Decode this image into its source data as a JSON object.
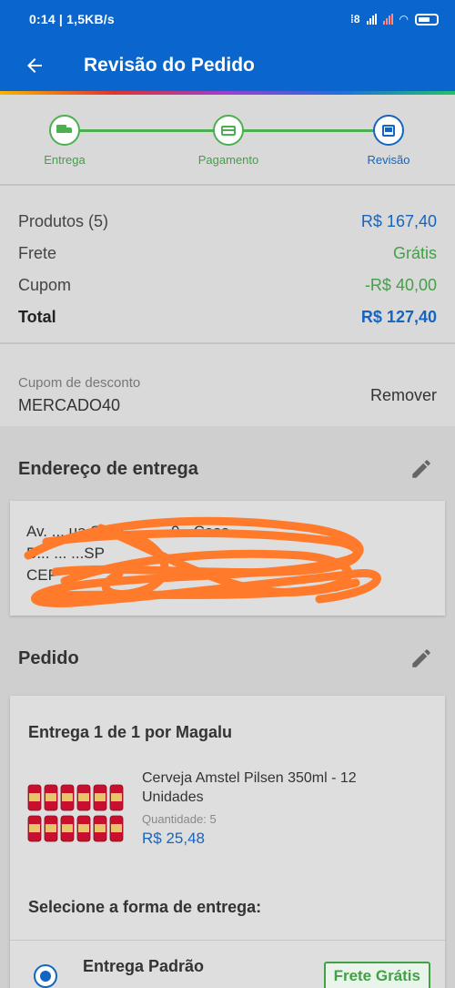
{
  "status_bar": {
    "time_info": "0:14 | 1,5KB/s",
    "alarm_icon": "alarm-icon"
  },
  "app_bar": {
    "title": "Revisão do Pedido"
  },
  "stepper": {
    "steps": [
      {
        "label": "Entrega",
        "state": "done",
        "icon": "truck-icon"
      },
      {
        "label": "Pagamento",
        "state": "done",
        "icon": "card-icon"
      },
      {
        "label": "Revisão",
        "state": "current",
        "icon": "screen-icon"
      }
    ]
  },
  "summary": {
    "products_label": "Produtos (5)",
    "products_value": "R$ 167,40",
    "shipping_label": "Frete",
    "shipping_value": "Grátis",
    "coupon_label": "Cupom",
    "coupon_value": "-R$ 40,00",
    "total_label": "Total",
    "total_value": "R$ 127,40"
  },
  "coupon": {
    "label": "Cupom de desconto",
    "code": "MERCADO40",
    "remove_label": "Remover"
  },
  "address": {
    "title": "Endereço de entrega",
    "line1": "Av. ... ua Silva ... , ... 0 - Casa",
    "line2": "B... ... ...SP",
    "line3": "CEP ..."
  },
  "order": {
    "title": "Pedido",
    "shipment_title": "Entrega 1 de 1 por Magalu",
    "product": {
      "name": "Cerveja Amstel Pilsen 350ml - 12 Unidades",
      "quantity": "Quantidade: 5",
      "price": "R$ 25,48"
    },
    "delivery_question": "Selecione a forma de entrega:",
    "delivery_option": {
      "name": "Entrega Padrão",
      "sub": "... ... ...",
      "badge": "Frete Grátis"
    }
  },
  "colors": {
    "primary": "#0a66cc",
    "link_blue": "#1565c0",
    "success_green": "#43a047",
    "scribble_orange": "#ff7a2a"
  }
}
